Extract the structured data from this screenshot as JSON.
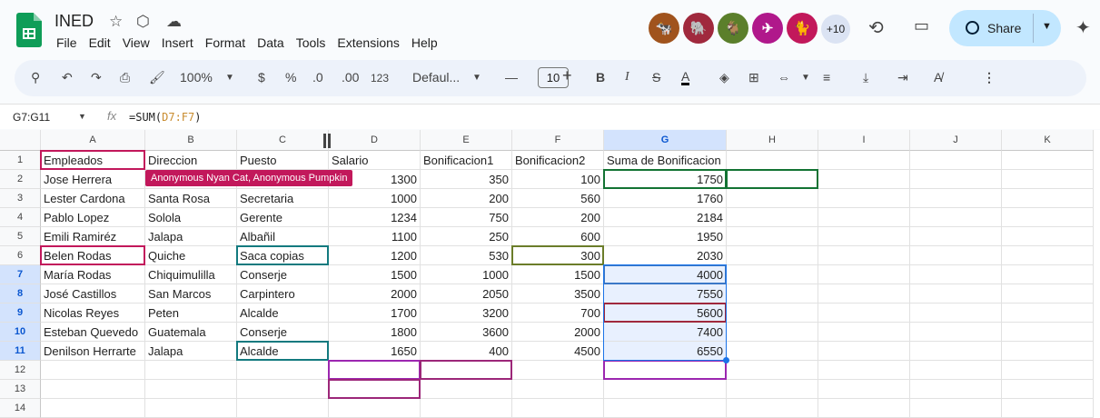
{
  "app": {
    "title": "INED"
  },
  "menu": [
    "File",
    "Edit",
    "View",
    "Insert",
    "Format",
    "Data",
    "Tools",
    "Extensions",
    "Help"
  ],
  "collaborators": {
    "more": "+10",
    "colors": [
      "#a0531d",
      "#a0293d",
      "#5b7f2b",
      "#b0188b",
      "#c2185b"
    ]
  },
  "share": {
    "label": "Share"
  },
  "toolbar": {
    "zoom": "100%",
    "currency": "$",
    "percent": "%",
    "dec_minus": ".0",
    "dec_plus": ".00",
    "format123": "123",
    "font": "Defaul...",
    "font_size": "10"
  },
  "namebox": "G7:G11",
  "formula": {
    "prefix": "=SUM(",
    "range": "D7:F7",
    "suffix": ")"
  },
  "columns": [
    "A",
    "B",
    "C",
    "D",
    "E",
    "F",
    "G",
    "H",
    "I",
    "J",
    "K"
  ],
  "rows": [
    "1",
    "2",
    "3",
    "4",
    "5",
    "6",
    "7",
    "8",
    "9",
    "10",
    "11",
    "12",
    "13",
    "14"
  ],
  "cells": [
    [
      "Empleados",
      "Direccion",
      "Puesto",
      "Salario",
      "Bonificacion1",
      "Bonificacion2",
      "Suma de Bonificacion"
    ],
    [
      "Jose Herrera",
      "",
      "",
      "1300",
      "350",
      "100",
      "1750"
    ],
    [
      "Lester Cardona",
      "Santa Rosa",
      "Secretaria",
      "1000",
      "200",
      "560",
      "1760"
    ],
    [
      "Pablo Lopez",
      "Solola",
      "Gerente",
      "1234",
      "750",
      "200",
      "2184"
    ],
    [
      "Emili Ramiréz",
      "Jalapa",
      "Albañil",
      "1100",
      "250",
      "600",
      "1950"
    ],
    [
      "Belen Rodas",
      "Quiche",
      "Saca copias",
      "1200",
      "530",
      "300",
      "2030"
    ],
    [
      "María Rodas",
      "Chiquimulilla",
      "Conserje",
      "1500",
      "1000",
      "1500",
      "4000"
    ],
    [
      "José Castillos",
      "San Marcos",
      "Carpintero",
      "2000",
      "2050",
      "3500",
      "7550"
    ],
    [
      "Nicolas Reyes",
      "Peten",
      "Alcalde",
      "1700",
      "3200",
      "700",
      "5600"
    ],
    [
      "Esteban Quevedo",
      "Guatemala",
      "Conserje",
      "1800",
      "3600",
      "2000",
      "7400"
    ],
    [
      "Denilson Herrarte",
      "Jalapa",
      "Alcalde",
      "1650",
      "400",
      "4500",
      "6550"
    ]
  ],
  "collab_tag": "Anonymous Nyan Cat, Anonymous Pumpkin"
}
